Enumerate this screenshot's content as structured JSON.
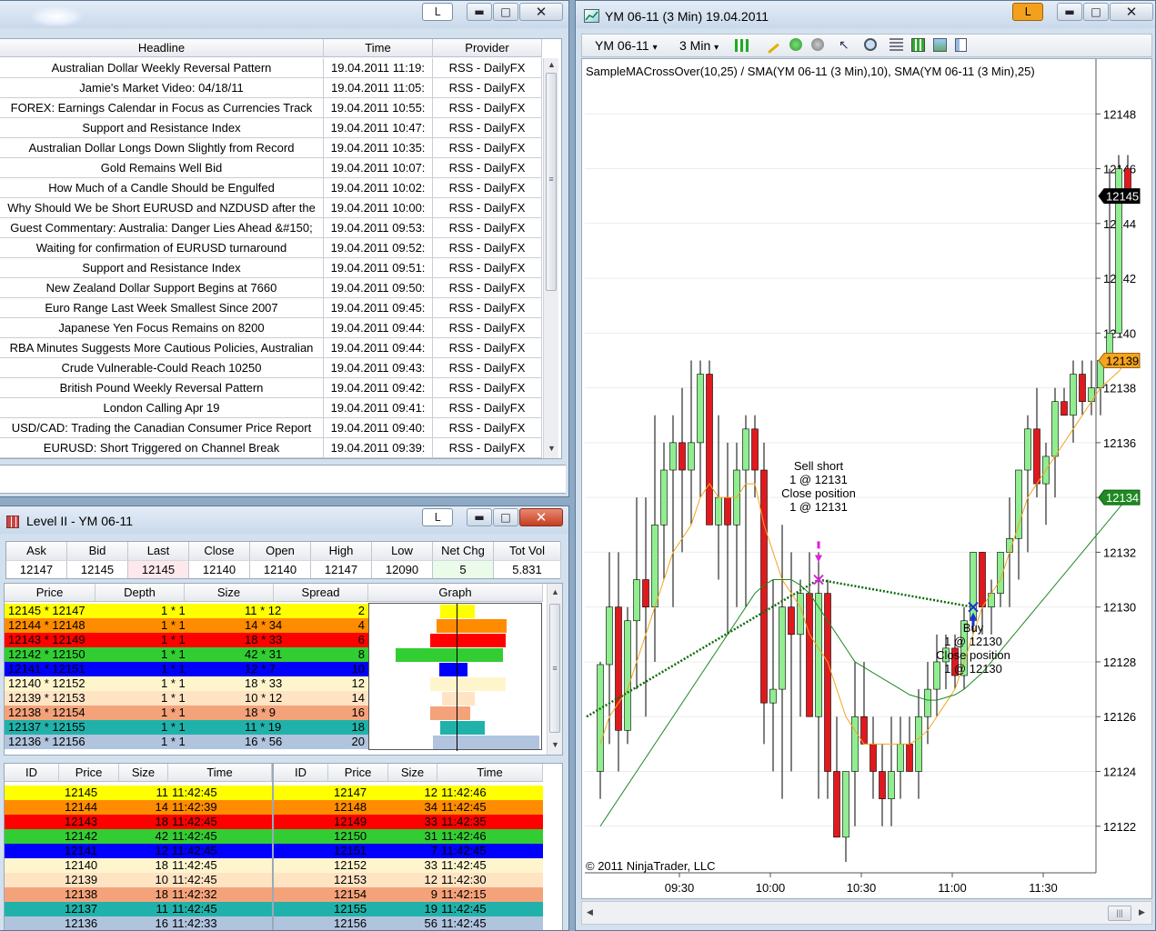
{
  "news": {
    "columns": [
      "Headline",
      "Time",
      "Provider"
    ],
    "rows": [
      [
        "Australian Dollar Weekly Reversal Pattern",
        "19.04.2011 11:19:",
        "RSS - DailyFX"
      ],
      [
        "Jamie's Market Video: 04/18/11",
        "19.04.2011 11:05:",
        "RSS - DailyFX"
      ],
      [
        "FOREX: Earnings Calendar in Focus as Currencies Track",
        "19.04.2011 10:55:",
        "RSS - DailyFX"
      ],
      [
        "Support and Resistance Index",
        "19.04.2011 10:47:",
        "RSS - DailyFX"
      ],
      [
        "Australian Dollar Longs Down Slightly from Record",
        "19.04.2011 10:35:",
        "RSS - DailyFX"
      ],
      [
        "Gold Remains Well Bid",
        "19.04.2011 10:07:",
        "RSS - DailyFX"
      ],
      [
        "How Much of a Candle Should be Engulfed",
        "19.04.2011 10:02:",
        "RSS - DailyFX"
      ],
      [
        "Why Should We be Short EURUSD and NZDUSD after the",
        "19.04.2011 10:00:",
        "RSS - DailyFX"
      ],
      [
        "Guest Commentary: Australia: Danger Lies Ahead &#150;",
        "19.04.2011 09:53:",
        "RSS - DailyFX"
      ],
      [
        "Waiting for confirmation of EURUSD turnaround",
        "19.04.2011 09:52:",
        "RSS - DailyFX"
      ],
      [
        "Support and Resistance Index",
        "19.04.2011 09:51:",
        "RSS - DailyFX"
      ],
      [
        "New Zealand Dollar Support Begins at 7660",
        "19.04.2011 09:50:",
        "RSS - DailyFX"
      ],
      [
        "Euro Range Last Week Smallest Since 2007",
        "19.04.2011 09:45:",
        "RSS - DailyFX"
      ],
      [
        "Japanese Yen Focus Remains on 8200",
        "19.04.2011 09:44:",
        "RSS - DailyFX"
      ],
      [
        "RBA Minutes Suggests More Cautious Policies, Australian",
        "19.04.2011 09:44:",
        "RSS - DailyFX"
      ],
      [
        "Crude Vulnerable-Could Reach 10250",
        "19.04.2011 09:43:",
        "RSS - DailyFX"
      ],
      [
        "British Pound Weekly Reversal Pattern",
        "19.04.2011 09:42:",
        "RSS - DailyFX"
      ],
      [
        "London Calling Apr 19",
        "19.04.2011 09:41:",
        "RSS - DailyFX"
      ],
      [
        "USD/CAD: Trading the Canadian Consumer Price Report",
        "19.04.2011 09:40:",
        "RSS - DailyFX"
      ],
      [
        "EURUSD: Short Triggered on Channel Break",
        "19.04.2011 09:39:",
        "RSS - DailyFX"
      ]
    ]
  },
  "buttons": {
    "link": "L",
    "minimize": "▬",
    "maximize": "□",
    "close": "✕",
    "dropdown": "▾"
  },
  "level2": {
    "title": "Level II - YM 06-11",
    "summary_headers": [
      "Ask",
      "Bid",
      "Last",
      "Close",
      "Open",
      "High",
      "Low",
      "Net Chg",
      "Tot Vol"
    ],
    "summary_values": [
      "12147",
      "12145",
      "12145",
      "12140",
      "12140",
      "12147",
      "12090",
      "5",
      "5.831"
    ],
    "depth_headers": [
      "Price",
      "Depth",
      "Size",
      "Spread",
      "Graph"
    ],
    "depth_rows": [
      {
        "price": "12145 * 12147",
        "depth": "1 * 1",
        "size": "11 * 12",
        "spread": "2",
        "color": "#ffff00",
        "text": "#000000",
        "bid": 11,
        "ask": 12
      },
      {
        "price": "12144 * 12148",
        "depth": "1 * 1",
        "size": "14 * 34",
        "spread": "4",
        "color": "#ff8c00",
        "text": "#000000",
        "bid": 14,
        "ask": 34
      },
      {
        "price": "12143 * 12149",
        "depth": "1 * 1",
        "size": "18 * 33",
        "spread": "6",
        "color": "#ff0000",
        "text": "#000000",
        "bid": 18,
        "ask": 33
      },
      {
        "price": "12142 * 12150",
        "depth": "1 * 1",
        "size": "42 * 31",
        "spread": "8",
        "color": "#32cd32",
        "text": "#000000",
        "bid": 42,
        "ask": 31
      },
      {
        "price": "12141 * 12151",
        "depth": "1 * 1",
        "size": "12 * 7",
        "spread": "10",
        "color": "#0000ff",
        "text": "#000000",
        "bid": 12,
        "ask": 7
      },
      {
        "price": "12140 * 12152",
        "depth": "1 * 1",
        "size": "18 * 33",
        "spread": "12",
        "color": "#fff5cc",
        "text": "#000000",
        "bid": 18,
        "ask": 33
      },
      {
        "price": "12139 * 12153",
        "depth": "1 * 1",
        "size": "10 * 12",
        "spread": "14",
        "color": "#ffe4c4",
        "text": "#000000",
        "bid": 10,
        "ask": 12
      },
      {
        "price": "12138 * 12154",
        "depth": "1 * 1",
        "size": "18 * 9",
        "spread": "16",
        "color": "#f4a27a",
        "text": "#000000",
        "bid": 18,
        "ask": 9
      },
      {
        "price": "12137 * 12155",
        "depth": "1 * 1",
        "size": "11 * 19",
        "spread": "18",
        "color": "#20b2aa",
        "text": "#000000",
        "bid": 11,
        "ask": 19
      },
      {
        "price": "12136 * 12156",
        "depth": "1 * 1",
        "size": "16 * 56",
        "spread": "20",
        "color": "#b0c4de",
        "text": "#000000",
        "bid": 16,
        "ask": 56
      }
    ],
    "book_headers": [
      "ID",
      "Price",
      "Size",
      "Time"
    ],
    "bid_rows": [
      [
        "",
        "12145",
        "11",
        "11:42:45"
      ],
      [
        "",
        "12144",
        "14",
        "11:42:39"
      ],
      [
        "",
        "12143",
        "18",
        "11:42:45"
      ],
      [
        "",
        "12142",
        "42",
        "11:42:45"
      ],
      [
        "",
        "12141",
        "12",
        "11:42:45"
      ],
      [
        "",
        "12140",
        "18",
        "11:42:45"
      ],
      [
        "",
        "12139",
        "10",
        "11:42:45"
      ],
      [
        "",
        "12138",
        "18",
        "11:42:32"
      ],
      [
        "",
        "12137",
        "11",
        "11:42:45"
      ],
      [
        "",
        "12136",
        "16",
        "11:42:33"
      ]
    ],
    "ask_rows": [
      [
        "",
        "12147",
        "12",
        "11:42:46"
      ],
      [
        "",
        "12148",
        "34",
        "11:42:45"
      ],
      [
        "",
        "12149",
        "33",
        "11:42:35"
      ],
      [
        "",
        "12150",
        "31",
        "11:42:46"
      ],
      [
        "",
        "12151",
        "7",
        "11:42:45"
      ],
      [
        "",
        "12152",
        "33",
        "11:42:45"
      ],
      [
        "",
        "12153",
        "12",
        "11:42:30"
      ],
      [
        "",
        "12154",
        "9",
        "11:42:15"
      ],
      [
        "",
        "12155",
        "19",
        "11:42:45"
      ],
      [
        "",
        "12156",
        "56",
        "11:42:45"
      ]
    ]
  },
  "chart": {
    "title": "YM 06-11 (3 Min)  19.04.2011",
    "instrument": "YM 06-11",
    "period": "3 Min",
    "indicator_label": "SampleMACrossOver(10,25)  /  SMA(YM 06-11 (3 Min),10),  SMA(YM 06-11 (3 Min),25)",
    "copyright": "© 2011 NinjaTrader, LLC",
    "sell_label": [
      "Sell short",
      "1 @ 12131",
      "Close position",
      "1 @ 12131"
    ],
    "buy_label": [
      "Buy",
      "1 @ 12130",
      "Close position",
      "1 @ 12130"
    ],
    "price_markers": {
      "last": "12145",
      "sma_fast": "12139",
      "sma_slow": "12134"
    },
    "colors": {
      "up": "#90ee90",
      "down": "#e0191e",
      "sma_fast": "#f4a41e",
      "sma_slow": "#1f8a22"
    }
  },
  "chart_data": {
    "type": "candlestick",
    "title": "YM 06-11 (3 Min)  19.04.2011",
    "yticks": [
      12122,
      12124,
      12126,
      12128,
      12130,
      12132,
      12134,
      12136,
      12138,
      12140,
      12142,
      12144,
      12146,
      12148
    ],
    "xticks": [
      "09:30",
      "10:00",
      "10:30",
      "11:00",
      "11:30"
    ],
    "ylim": [
      12120.3,
      12150.0
    ],
    "candles": [
      {
        "o": 12124,
        "h": 12128,
        "l": 12123,
        "c": 12127.9
      },
      {
        "o": 12127.9,
        "h": 12132,
        "l": 12125,
        "c": 12130
      },
      {
        "o": 12130,
        "h": 12132,
        "l": 12124,
        "c": 12125.5
      },
      {
        "o": 12125.5,
        "h": 12130,
        "l": 12125,
        "c": 12129.5
      },
      {
        "o": 12129.5,
        "h": 12134,
        "l": 12127,
        "c": 12131
      },
      {
        "o": 12131,
        "h": 12134,
        "l": 12126,
        "c": 12130
      },
      {
        "o": 12130,
        "h": 12137,
        "l": 12128,
        "c": 12133
      },
      {
        "o": 12133,
        "h": 12136,
        "l": 12131,
        "c": 12135
      },
      {
        "o": 12135,
        "h": 12137,
        "l": 12130,
        "c": 12136
      },
      {
        "o": 12136,
        "h": 12138,
        "l": 12132,
        "c": 12135
      },
      {
        "o": 12135,
        "h": 12139,
        "l": 12133,
        "c": 12136
      },
      {
        "o": 12136,
        "h": 12139,
        "l": 12134,
        "c": 12138.5
      },
      {
        "o": 12138.5,
        "h": 12139,
        "l": 12133,
        "c": 12133
      },
      {
        "o": 12133,
        "h": 12137,
        "l": 12131,
        "c": 12134
      },
      {
        "o": 12134,
        "h": 12136,
        "l": 12129,
        "c": 12133
      },
      {
        "o": 12133,
        "h": 12136,
        "l": 12130,
        "c": 12135
      },
      {
        "o": 12135,
        "h": 12137,
        "l": 12130,
        "c": 12136.5
      },
      {
        "o": 12136.5,
        "h": 12137,
        "l": 12134,
        "c": 12135
      },
      {
        "o": 12135,
        "h": 12136,
        "l": 12125,
        "c": 12126.5
      },
      {
        "o": 12126.5,
        "h": 12131,
        "l": 12124,
        "c": 12127
      },
      {
        "o": 12127,
        "h": 12133,
        "l": 12123,
        "c": 12130
      },
      {
        "o": 12130,
        "h": 12132,
        "l": 12124,
        "c": 12129
      },
      {
        "o": 12129,
        "h": 12131,
        "l": 12126,
        "c": 12130.5
      },
      {
        "o": 12130.5,
        "h": 12132,
        "l": 12126,
        "c": 12126
      },
      {
        "o": 12126,
        "h": 12132,
        "l": 12123,
        "c": 12130.5
      },
      {
        "o": 12130.5,
        "h": 12131,
        "l": 12123,
        "c": 12124
      },
      {
        "o": 12124,
        "h": 12126,
        "l": 12122,
        "c": 12121.6
      },
      {
        "o": 12121.6,
        "h": 12124,
        "l": 12120.7,
        "c": 12124
      },
      {
        "o": 12124,
        "h": 12128,
        "l": 12122,
        "c": 12126
      },
      {
        "o": 12126,
        "h": 12128,
        "l": 12125,
        "c": 12125
      },
      {
        "o": 12125,
        "h": 12126,
        "l": 12123,
        "c": 12124
      },
      {
        "o": 12124,
        "h": 12125,
        "l": 12122,
        "c": 12123
      },
      {
        "o": 12123,
        "h": 12126,
        "l": 12122,
        "c": 12124
      },
      {
        "o": 12124,
        "h": 12126,
        "l": 12123,
        "c": 12125
      },
      {
        "o": 12125,
        "h": 12126,
        "l": 12124,
        "c": 12124
      },
      {
        "o": 12124,
        "h": 12127,
        "l": 12123,
        "c": 12126
      },
      {
        "o": 12126,
        "h": 12128,
        "l": 12125,
        "c": 12127
      },
      {
        "o": 12127,
        "h": 12129,
        "l": 12126,
        "c": 12128
      },
      {
        "o": 12128,
        "h": 12129,
        "l": 12127,
        "c": 12128.5
      },
      {
        "o": 12128.5,
        "h": 12129,
        "l": 12127,
        "c": 12127.5
      },
      {
        "o": 12127.5,
        "h": 12130,
        "l": 12127,
        "c": 12129.5
      },
      {
        "o": 12129.5,
        "h": 12132,
        "l": 12129,
        "c": 12132
      },
      {
        "o": 12132,
        "h": 12132,
        "l": 12129,
        "c": 12130
      },
      {
        "o": 12130,
        "h": 12131,
        "l": 12129,
        "c": 12130.5
      },
      {
        "o": 12130.5,
        "h": 12132,
        "l": 12130,
        "c": 12132
      },
      {
        "o": 12132,
        "h": 12134,
        "l": 12130,
        "c": 12132.5
      },
      {
        "o": 12132.5,
        "h": 12135,
        "l": 12131,
        "c": 12135
      },
      {
        "o": 12135,
        "h": 12137,
        "l": 12132,
        "c": 12136.5
      },
      {
        "o": 12136.5,
        "h": 12138,
        "l": 12134,
        "c": 12134.5
      },
      {
        "o": 12134.5,
        "h": 12136,
        "l": 12133,
        "c": 12135.5
      },
      {
        "o": 12135.5,
        "h": 12138,
        "l": 12134,
        "c": 12137.5
      },
      {
        "o": 12137.5,
        "h": 12138,
        "l": 12137,
        "c": 12137
      },
      {
        "o": 12137,
        "h": 12139,
        "l": 12136,
        "c": 12138.5
      },
      {
        "o": 12138.5,
        "h": 12139,
        "l": 12137,
        "c": 12137.5
      },
      {
        "o": 12137.5,
        "h": 12139,
        "l": 12137,
        "c": 12138
      },
      {
        "o": 12138,
        "h": 12139,
        "l": 12137,
        "c": 12139
      },
      {
        "o": 12139,
        "h": 12146,
        "l": 12139,
        "c": 12140
      },
      {
        "o": 12140,
        "h": 12146.5,
        "l": 12140,
        "c": 12146
      },
      {
        "o": 12146,
        "h": 12146.5,
        "l": 12145,
        "c": 12145
      }
    ],
    "sma_fast": [
      12125,
      12126,
      12126.5,
      12127,
      12128,
      12129,
      12130,
      12131,
      12132,
      12132.5,
      12133,
      12134,
      12134.5,
      12134,
      12134,
      12134,
      12134.5,
      12134.5,
      12133,
      12132,
      12131,
      12130.5,
      12130,
      12129,
      12128.5,
      12128,
      12127,
      12126,
      12125.5,
      12125,
      12125,
      12125,
      12125,
      12125,
      12125,
      12125.2,
      12125.5,
      12126,
      12126.5,
      12127,
      12128,
      12129,
      12130,
      12130.5,
      12131,
      12132,
      12133,
      12134,
      12134.5,
      12135,
      12135.5,
      12136,
      12136.5,
      12137,
      12137.5,
      12138,
      12138.3,
      12138.6,
      12139
    ],
    "sma_slow": [
      12122,
      12122.5,
      12123,
      12123.5,
      12124,
      12124.5,
      12125,
      12125.5,
      12126,
      12126.5,
      12127,
      12127.5,
      12128,
      12128.5,
      12129,
      12129.5,
      12130,
      12130.5,
      12130.8,
      12131,
      12131,
      12131,
      12130.8,
      12130.5,
      12130,
      12129.5,
      12129,
      12128.5,
      12128,
      12127.8,
      12127.6,
      12127.4,
      12127.2,
      12127,
      12126.8,
      12126.7,
      12126.6,
      12126.6,
      12126.7,
      12126.8,
      12127,
      12127.3,
      12127.6,
      12128,
      12128.4,
      12128.8,
      12129.2,
      12129.6,
      12130,
      12130.4,
      12130.8,
      12131.2,
      12131.6,
      12132,
      12132.4,
      12132.8,
      12133.2,
      12133.6,
      12134
    ]
  }
}
